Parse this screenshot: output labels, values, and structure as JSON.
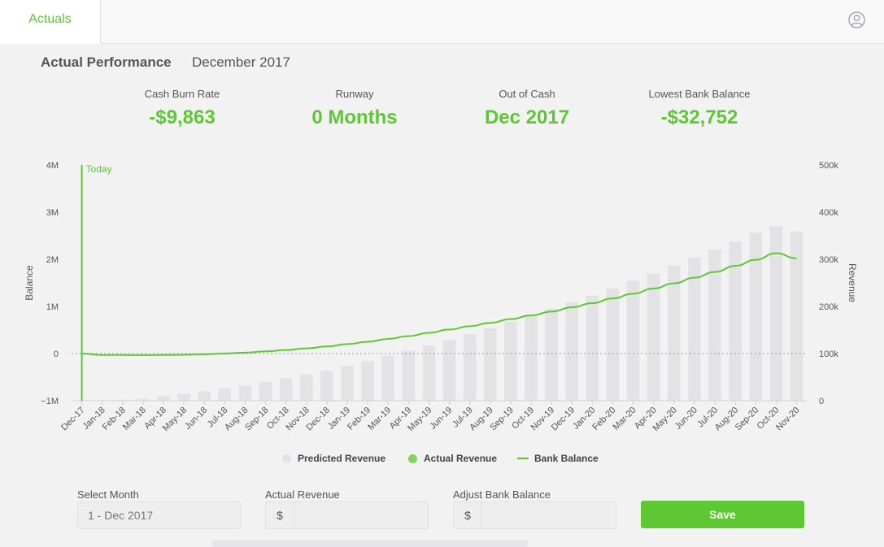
{
  "header": {
    "tab_label": "Actuals",
    "user_icon": "user-circle-icon"
  },
  "page": {
    "title": "Actual Performance",
    "subtitle": "December 2017"
  },
  "stats": [
    {
      "label": "Cash Burn Rate",
      "value": "-$9,863"
    },
    {
      "label": "Runway",
      "value": "0 Months"
    },
    {
      "label": "Out of Cash",
      "value": "Dec 2017"
    },
    {
      "label": "Lowest Bank Balance",
      "value": "-$32,752"
    }
  ],
  "colors": {
    "accent": "#5ec832",
    "bar": "#e3e3e6",
    "text": "#444444"
  },
  "chart_data": {
    "type": "bar",
    "categories": [
      "Dec-17",
      "Jan-18",
      "Feb-18",
      "Mar-18",
      "Apr-18",
      "May-18",
      "Jun-18",
      "Jul-18",
      "Aug-18",
      "Sep-18",
      "Oct-18",
      "Nov-18",
      "Dec-18",
      "Jan-19",
      "Feb-19",
      "Mar-19",
      "Apr-19",
      "May-19",
      "Jun-19",
      "Jul-19",
      "Aug-19",
      "Sep-19",
      "Oct-19",
      "Nov-19",
      "Dec-19",
      "Jan-20",
      "Feb-20",
      "Mar-20",
      "Apr-20",
      "May-20",
      "Jun-20",
      "Jul-20",
      "Aug-20",
      "Sep-20",
      "Oct-20",
      "Nov-20"
    ],
    "series": [
      {
        "name": "Predicted Revenue",
        "kind": "bar",
        "axis": "right",
        "values": [
          0,
          0,
          2000,
          4000,
          10000,
          15000,
          20000,
          26000,
          32000,
          40000,
          48000,
          56000,
          64000,
          74000,
          84000,
          95000,
          106000,
          117000,
          129000,
          141000,
          154000,
          167000,
          181000,
          195000,
          209000,
          223000,
          238000,
          254000,
          270000,
          287000,
          304000,
          321000,
          338000,
          356000,
          370000,
          359000
        ]
      },
      {
        "name": "Actual Revenue",
        "kind": "bar",
        "axis": "right",
        "values": []
      },
      {
        "name": "Bank Balance",
        "kind": "line",
        "axis": "left",
        "values": [
          0,
          -30000,
          -30000,
          -32752,
          -30000,
          -25000,
          -15000,
          0,
          20000,
          45000,
          75000,
          110000,
          150000,
          200000,
          250000,
          310000,
          370000,
          440000,
          510000,
          580000,
          650000,
          730000,
          810000,
          890000,
          980000,
          1070000,
          1170000,
          1270000,
          1380000,
          1490000,
          1610000,
          1730000,
          1860000,
          1990000,
          2130000,
          2020000
        ]
      }
    ],
    "left_axis": {
      "label": "Balance",
      "range": [
        -1000000,
        4000000
      ],
      "ticks": [
        -1000000,
        0,
        1000000,
        2000000,
        3000000,
        4000000
      ],
      "tick_labels": [
        "−1M",
        "0",
        "1M",
        "2M",
        "3M",
        "4M"
      ]
    },
    "right_axis": {
      "label": "Revenue",
      "range": [
        0,
        500000
      ],
      "ticks": [
        0,
        100000,
        200000,
        300000,
        400000,
        500000
      ],
      "tick_labels": [
        "0",
        "100k",
        "200k",
        "300k",
        "400k",
        "500k"
      ]
    },
    "marker": {
      "label": "Today",
      "category": "Dec-17"
    },
    "zero_line": "dotted",
    "grid": false,
    "legend": "bottom"
  },
  "form": {
    "select_month": {
      "label": "Select Month",
      "value": "1 - Dec 2017"
    },
    "actual_revenue": {
      "label": "Actual Revenue",
      "prefix": "$",
      "value": ""
    },
    "adjust_bank": {
      "label": "Adjust Bank Balance",
      "prefix": "$",
      "value": ""
    },
    "save_label": "Save"
  }
}
